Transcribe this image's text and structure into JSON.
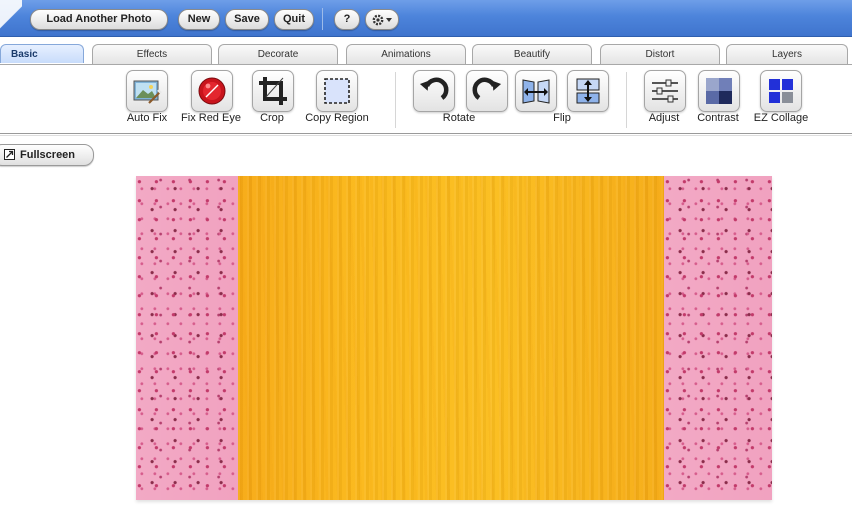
{
  "topbar": {
    "load_label": "Load Another Photo",
    "new_label": "New",
    "save_label": "Save",
    "quit_label": "Quit",
    "help_label": "?",
    "settings_icon": "gear-dropdown-icon"
  },
  "tabs": [
    {
      "label": "Basic",
      "active": true
    },
    {
      "label": "Effects"
    },
    {
      "label": "Decorate"
    },
    {
      "label": "Animations"
    },
    {
      "label": "Beautify"
    },
    {
      "label": "Distort"
    },
    {
      "label": "Layers"
    }
  ],
  "tools": {
    "auto_fix": "Auto Fix",
    "fix_red_eye": "Fix Red Eye",
    "crop": "Crop",
    "copy_region": "Copy Region",
    "rotate": "Rotate",
    "flip": "Flip",
    "adjust": "Adjust",
    "contrast": "Contrast",
    "ez_collage": "EZ Collage"
  },
  "fullscreen_label": "Fullscreen",
  "colors": {
    "topbar": "#4d84db",
    "pink_pattern": "#f1a2c0",
    "yellow_center": "#fbb81a"
  }
}
